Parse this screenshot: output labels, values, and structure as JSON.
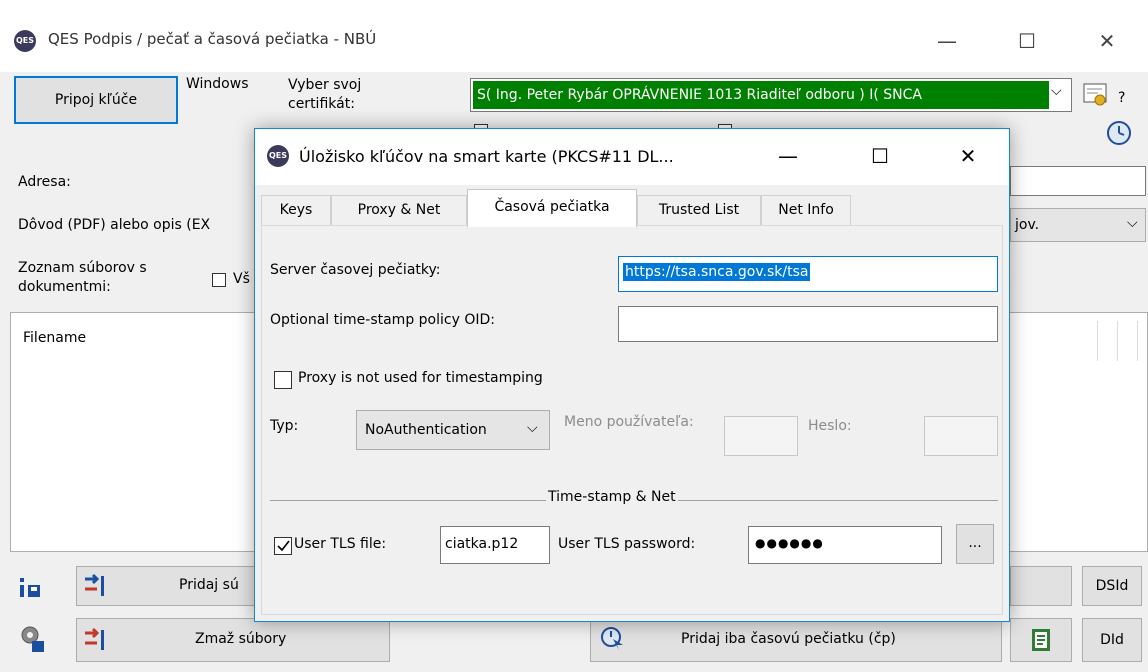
{
  "main": {
    "title": "QES Podpis / pečať a časová pečiatka - NBÚ",
    "app_icon": "QES",
    "connect_button": "Pripoj kľúče",
    "store_label": "Windows",
    "cert_label": "Vyber svoj certifikát:",
    "cert_value": "S( Ing. Peter Rybár OPRÁVNENIE 1013 Riaditeľ odboru ) I( SNCA",
    "cert_color": "#008000",
    "address_label": "Adresa:",
    "reason_label": "Dôvod (PDF) alebo opis (EX",
    "reason_value": "jov.",
    "files_label": "Zoznam súborov s dokumentmi:",
    "all_checkbox_label": "Vš",
    "filename_header": "Filename",
    "add_files_button": "Pridaj sú",
    "delete_files_button": "Zmaž súbory",
    "add_timestamp_button": "Pridaj iba časovú pečiatku (čp)",
    "dsid_button": "DSId",
    "did_button": "DId",
    "help_button": "?"
  },
  "dialog": {
    "title": "Úložisko kľúčov na smart karte (PKCS#11 DL...",
    "tabs": [
      {
        "label": "Keys"
      },
      {
        "label": "Proxy & Net"
      },
      {
        "label": "Časová pečiatka"
      },
      {
        "label": "Trusted List"
      },
      {
        "label": "Net Info"
      }
    ],
    "active_tab": "Časová pečiatka",
    "tsa_label": "Server časovej pečiatky:",
    "tsa_value": "https://tsa.snca.gov.sk/tsa",
    "oid_label": "Optional time-stamp policy OID:",
    "oid_value": "",
    "proxy_checkbox_label": "Proxy is not used for timestamping",
    "proxy_checked": false,
    "type_label": "Typ:",
    "type_value": "NoAuthentication",
    "username_label": "Meno používateľa:",
    "password_label": "Heslo:",
    "group_label": "Time-stamp & Net",
    "tls_checkbox_label": "User TLS file:",
    "tls_checked": true,
    "tls_file_value": "ciatka.p12",
    "tls_password_label": "User TLS password:",
    "tls_password_value": "●●●●●●",
    "browse_button": "..."
  },
  "colors": {
    "accent": "#0078d7",
    "selection": "#0078d7"
  }
}
